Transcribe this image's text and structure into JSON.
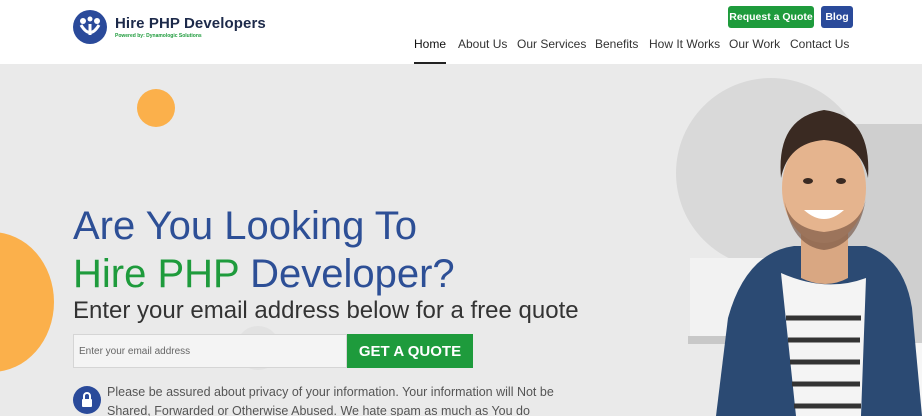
{
  "header": {
    "logo_title": "Hire PHP Developers",
    "logo_subtitle": "Powered by: Dynamologic Solutions",
    "request_quote_label": "Request a Quote",
    "blog_label": "Blog",
    "nav": [
      {
        "label": "Home",
        "active": true
      },
      {
        "label": "About Us",
        "active": false
      },
      {
        "label": "Our Services",
        "active": false
      },
      {
        "label": "Benefits",
        "active": false
      },
      {
        "label": "How It Works",
        "active": false
      },
      {
        "label": "Our Work",
        "active": false
      },
      {
        "label": "Contact Us",
        "active": false
      }
    ]
  },
  "hero": {
    "heading_line1": "Are You Looking To",
    "heading_line2_green": "Hire PHP",
    "heading_line2_blue": " Developer?",
    "subheading": "Enter your email address below for a free quote",
    "email_placeholder": "Enter your email address",
    "cta_label": "GET A QUOTE",
    "privacy_text": "Please be assured about privacy of your information. Your information will Not be Shared, Forwarded or Otherwise Abused. We hate spam as much as You do"
  },
  "colors": {
    "brand_blue": "#2d4f96",
    "brand_green": "#1e9b3c",
    "accent_orange": "#fbb04b",
    "hero_bg": "#eaeaea"
  },
  "icons": {
    "logo": "people-logo-icon",
    "lock": "lock-icon"
  }
}
